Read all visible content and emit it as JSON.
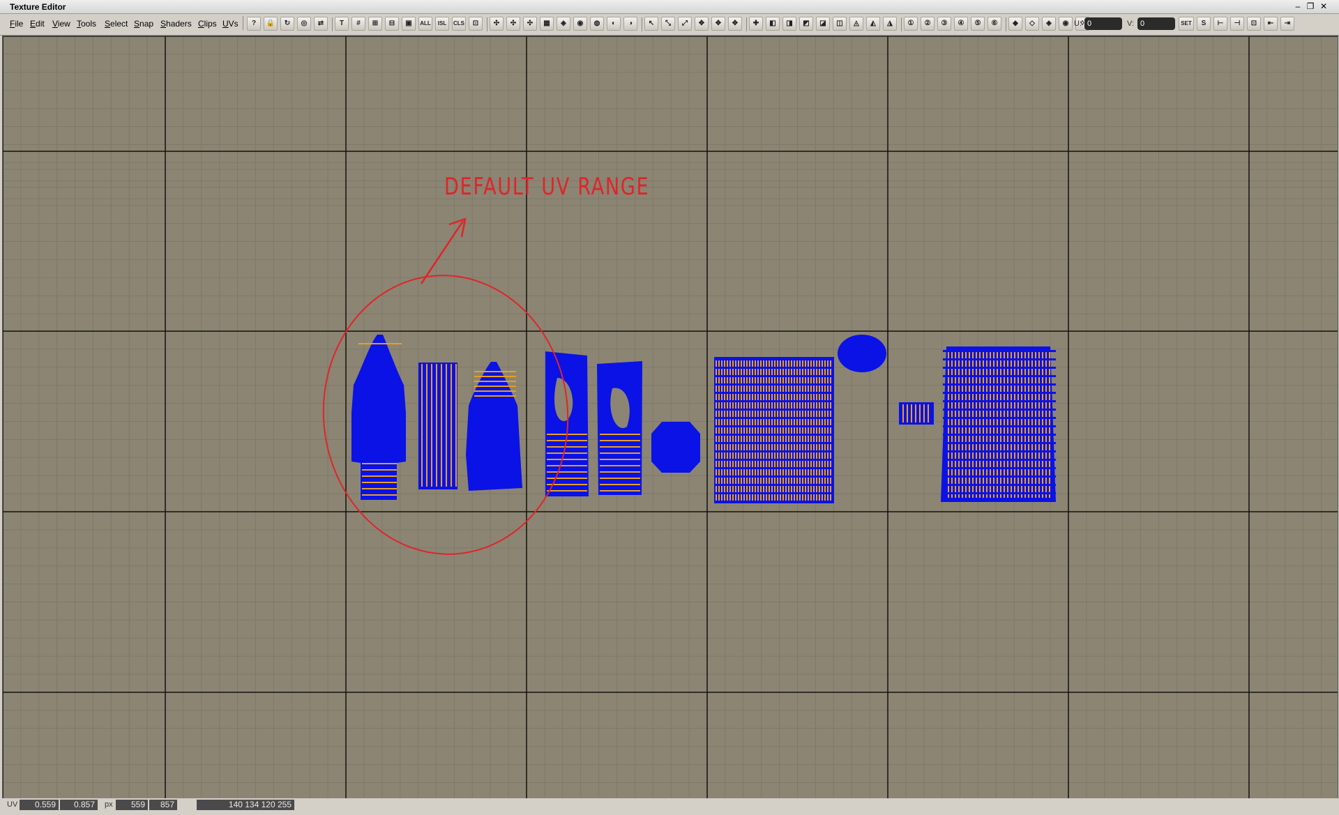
{
  "window": {
    "title": "Texture Editor",
    "controls": {
      "minimize": "–",
      "restore": "❐",
      "close": "✕"
    }
  },
  "menu": [
    "File",
    "Edit",
    "View",
    "Tools",
    "Select",
    "Snap",
    "Shaders",
    "Clips",
    "UVs"
  ],
  "toolbar": {
    "buttons": [
      "?",
      "🔒",
      "↻",
      "◎",
      "⇄",
      "T",
      "#",
      "⊞",
      "⊟",
      "▣",
      "ALL",
      "ISL",
      "CLS",
      "⊡",
      "✣",
      "✣",
      "✣",
      "▦",
      "◈",
      "◉",
      "◍",
      "◐",
      "◑",
      "↖",
      "⤡",
      "⤢",
      "✥",
      "✥",
      "✥",
      "✚",
      "◧",
      "◨",
      "◩",
      "◪",
      "◫",
      "◬",
      "◭",
      "◮",
      "①",
      "②",
      "③",
      "④",
      "⑤",
      "⑥",
      "◆",
      "◇",
      "◈",
      "◉",
      "◊"
    ],
    "u_label": "U:",
    "u_value": "0",
    "v_label": "V:",
    "v_value": "0",
    "set_label": "SET",
    "tail_buttons": [
      "S",
      "⊢",
      "⊣",
      "⊡",
      "⇤",
      "⇥"
    ]
  },
  "annotation": {
    "text": "DEFAULT UV RANGE",
    "color": "#e0242a"
  },
  "viewport": {
    "background": "#8c8573",
    "major_grid_color": "#111111",
    "minor_grid_color": "#7f796a",
    "uv_shell_color": "#0a12e6",
    "uv_edge_color": "#e8a020"
  },
  "status": {
    "uv_label": "UV",
    "u": "0.559",
    "v": "0.857",
    "px_label": "px",
    "px_x": "559",
    "px_y": "857",
    "rgba": "140 134 120 255"
  }
}
